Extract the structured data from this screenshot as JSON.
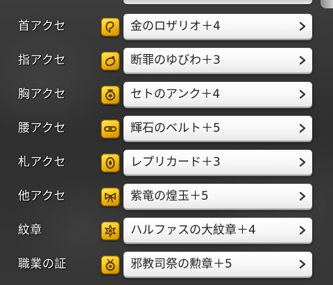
{
  "colors": {
    "label_text": "#ffffff",
    "button_text": "#222222",
    "icon_gold": "#f5c21a",
    "icon_outline": "#6b4400"
  },
  "equipment": [
    {
      "slot": "首アクセ",
      "item": "金のロザリオ＋4",
      "icon": "necklace-icon"
    },
    {
      "slot": "指アクセ",
      "item": "断罪のゆびわ＋3",
      "icon": "ring-icon"
    },
    {
      "slot": "胸アクセ",
      "item": "セトのアンク＋4",
      "icon": "brooch-icon"
    },
    {
      "slot": "腰アクセ",
      "item": "輝石のベルト＋5",
      "icon": "belt-icon"
    },
    {
      "slot": "札アクセ",
      "item": "レプリカード＋3",
      "icon": "card-icon"
    },
    {
      "slot": "他アクセ",
      "item": "紫竜の煌玉＋5",
      "icon": "ribbon-icon"
    },
    {
      "slot": "紋章",
      "item": "ハルファスの大紋章＋4",
      "icon": "emblem-icon"
    },
    {
      "slot": "職業の証",
      "item": "邪教司祭の勲章＋5",
      "icon": "medal-icon"
    }
  ]
}
